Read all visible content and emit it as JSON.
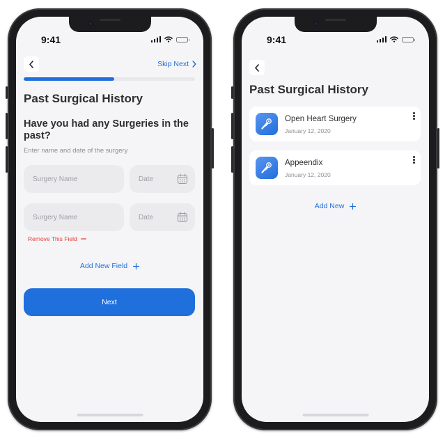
{
  "status": {
    "time": "9:41"
  },
  "form_screen": {
    "skip_label": "Skip Next",
    "progress": 0.53,
    "title": "Past Surgical History",
    "question": "Have you had any Surgeries in the past?",
    "hint": "Enter name and date of the surgery",
    "fields": [
      {
        "name_placeholder": "Surgery Name",
        "date_placeholder": "Date"
      },
      {
        "name_placeholder": "Surgery Name",
        "date_placeholder": "Date"
      }
    ],
    "remove_label": "Remove This Field",
    "add_field_label": "Add New Field",
    "next_label": "Next"
  },
  "list_screen": {
    "title": "Past Surgical History",
    "items": [
      {
        "name": "Open Heart Surgery",
        "date": "January 12, 2020"
      },
      {
        "name": "Appeendix",
        "date": "January 12, 2020"
      }
    ],
    "add_new_label": "Add New"
  },
  "colors": {
    "accent": "#1f6fdc",
    "danger": "#e53935",
    "background": "#f5f5f7"
  },
  "icons": [
    "back-chevron-icon",
    "forward-chevron-icon",
    "calendar-icon",
    "plus-icon",
    "minus-icon",
    "scalpel-icon",
    "more-vertical-icon",
    "signal-icon",
    "wifi-icon",
    "battery-icon"
  ]
}
